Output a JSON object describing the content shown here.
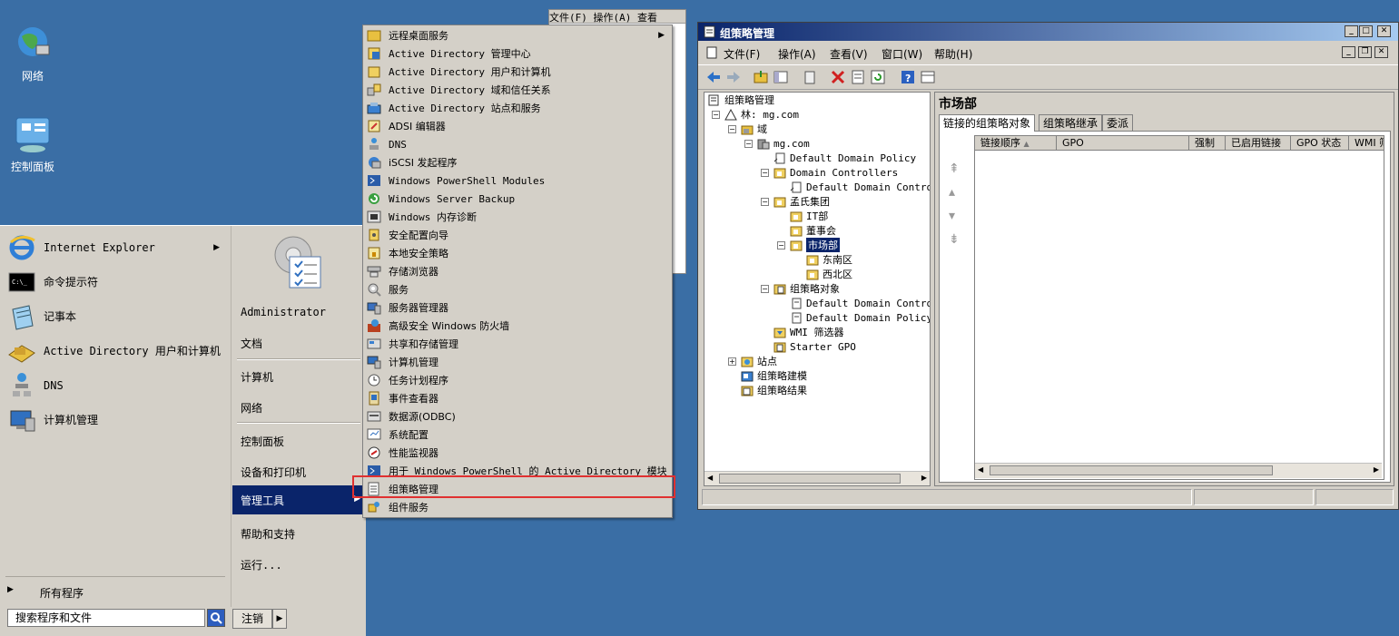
{
  "desktop": {
    "icons": [
      {
        "label": "网络",
        "icon": "network-icon"
      },
      {
        "label": "控制面板",
        "icon": "control-panel-icon"
      }
    ]
  },
  "behind_window": {
    "menu": "文件(F)   操作(A)   查看"
  },
  "start_menu": {
    "programs": [
      {
        "label": "Internet Explorer",
        "icon": "ie-icon",
        "has_submenu": true
      },
      {
        "label": "命令提示符",
        "icon": "cmd-icon"
      },
      {
        "label": "记事本",
        "icon": "notepad-icon"
      },
      {
        "label": "Active Directory 用户和计算机",
        "icon": "ad-users-icon"
      },
      {
        "label": "DNS",
        "icon": "dns-icon"
      },
      {
        "label": "计算机管理",
        "icon": "computer-mgmt-icon"
      }
    ],
    "all_programs": "所有程序",
    "search_placeholder": "搜索程序和文件",
    "user": "Administrator",
    "right_links": [
      "文档",
      "计算机",
      "网络",
      "控制面板",
      "设备和打印机",
      "管理工具",
      "帮助和支持",
      "运行..."
    ],
    "logoff": "注销"
  },
  "admin_tools": {
    "items": [
      "远程桌面服务",
      "Active Directory 管理中心",
      "Active Directory 用户和计算机",
      "Active Directory 域和信任关系",
      "Active Directory 站点和服务",
      "ADSI 编辑器",
      "DNS",
      "iSCSI 发起程序",
      "Windows PowerShell Modules",
      "Windows Server Backup",
      "Windows 内存诊断",
      "安全配置向导",
      "本地安全策略",
      "存储浏览器",
      "服务",
      "服务器管理器",
      "高级安全 Windows 防火墙",
      "共享和存储管理",
      "计算机管理",
      "任务计划程序",
      "事件查看器",
      "数据源(ODBC)",
      "系统配置",
      "性能监视器",
      "用于 Windows PowerShell 的 Active Directory 模块",
      "组策略管理",
      "组件服务"
    ],
    "highlighted": "组策略管理"
  },
  "gpmc": {
    "title": "组策略管理",
    "menu": [
      "文件(F)",
      "操作(A)",
      "查看(V)",
      "窗口(W)",
      "帮助(H)"
    ],
    "tree": [
      {
        "label": "组策略管理",
        "icon": "gpmc-icon"
      },
      {
        "label": "林: mg.com",
        "icon": "forest-icon"
      },
      {
        "label": "域",
        "icon": "domains-icon"
      },
      {
        "label": "mg.com",
        "icon": "domain-icon"
      },
      {
        "label": "Default Domain Policy",
        "icon": "gpo-link-icon"
      },
      {
        "label": "Domain Controllers",
        "icon": "ou-icon"
      },
      {
        "label": "Default Domain Controllers Policy",
        "icon": "gpo-link-icon"
      },
      {
        "label": "孟氏集团",
        "icon": "ou-icon"
      },
      {
        "label": "IT部",
        "icon": "ou-icon"
      },
      {
        "label": "董事会",
        "icon": "ou-icon"
      },
      {
        "label": "市场部",
        "icon": "ou-icon"
      },
      {
        "label": "东南区",
        "icon": "ou-icon"
      },
      {
        "label": "西北区",
        "icon": "ou-icon"
      },
      {
        "label": "组策略对象",
        "icon": "gpo-folder-icon"
      },
      {
        "label": "Default Domain Controllers Policy",
        "icon": "gpo-icon"
      },
      {
        "label": "Default Domain Policy",
        "icon": "gpo-icon"
      },
      {
        "label": "WMI 筛选器",
        "icon": "wmi-icon"
      },
      {
        "label": "Starter GPO",
        "icon": "starter-gpo-icon"
      },
      {
        "label": "站点",
        "icon": "sites-icon"
      },
      {
        "label": "组策略建模",
        "icon": "modeling-icon"
      },
      {
        "label": "组策略结果",
        "icon": "results-icon"
      }
    ],
    "selected": "市场部",
    "pane_title": "市场部",
    "tabs": [
      "链接的组策略对象",
      "组策略继承",
      "委派"
    ],
    "columns": [
      "链接顺序",
      "GPO",
      "强制",
      "已启用链接",
      "GPO 状态",
      "WMI 筛"
    ]
  }
}
